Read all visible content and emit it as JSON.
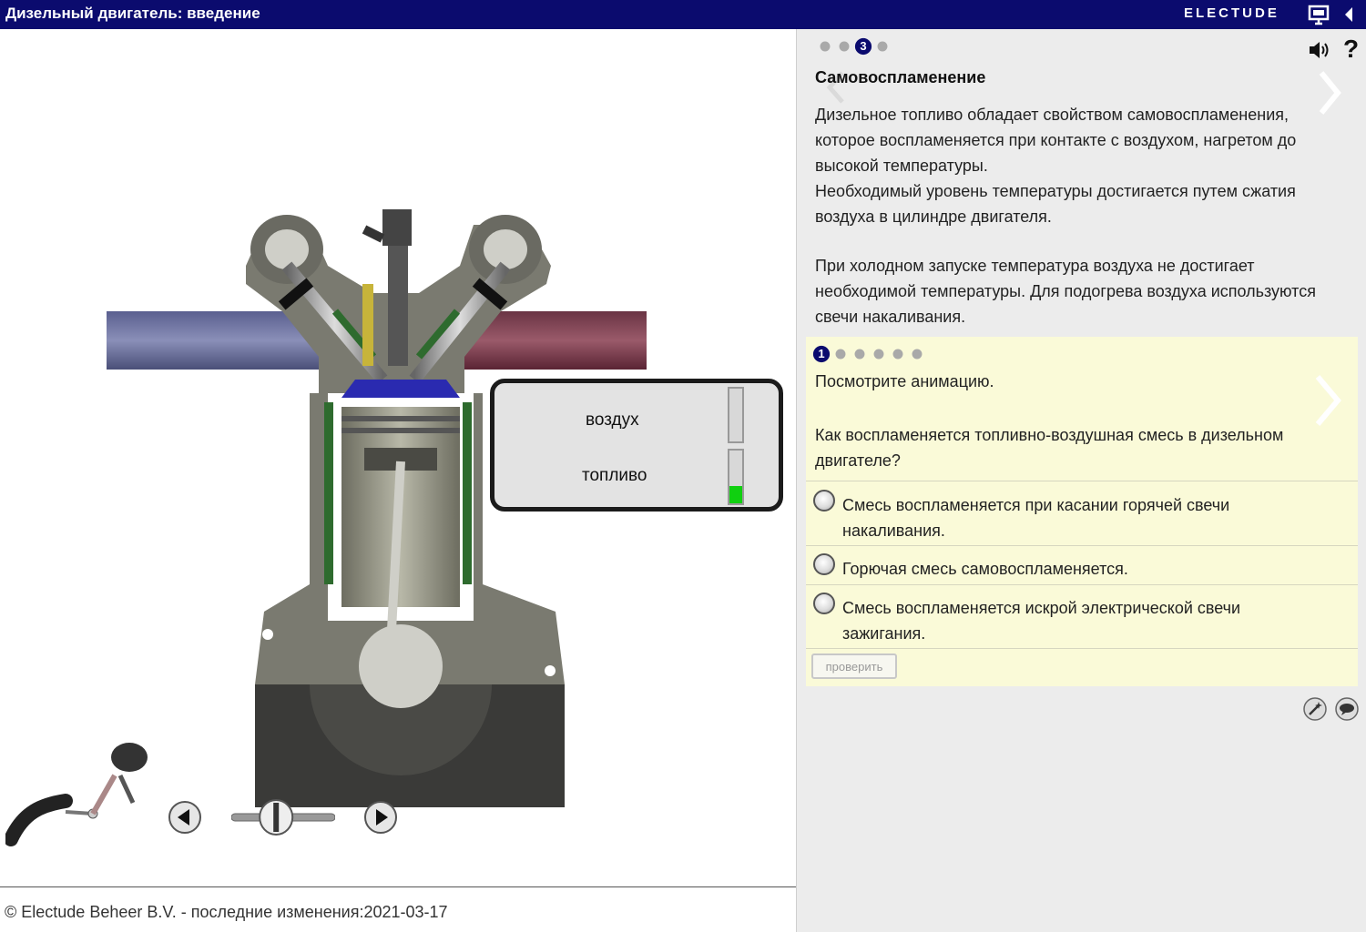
{
  "header": {
    "title": "Дизельный двигатель: введение",
    "brand": "ELECTUDE"
  },
  "animation": {
    "levels": [
      {
        "label": "воздух",
        "level": 0.0
      },
      {
        "label": "топливо",
        "level": 0.32
      }
    ],
    "slider_position": 0.4
  },
  "footer": {
    "copyright": "© Electude Beheer B.V. - последние изменения:2021-03-17"
  },
  "panel": {
    "page_dots": [
      "",
      "",
      "3",
      ""
    ],
    "active_page_dot": 2,
    "section_title": "Самовоспламенение",
    "paragraphs": [
      "Дизельное топливо обладает свойством самовоспламенения, которое воспламеняется при контакте с воздухом, нагретом до высокой температуры.",
      "Необходимый уровень температуры достигается путем сжатия воздуха в цилиндре двигателя.",
      "При холодном запуске температура воздуха не достигает необходимой температуры. Для подогрева воздуха используются свечи накаливания."
    ]
  },
  "quiz": {
    "dots": [
      "1",
      "",
      "",
      "",
      "",
      ""
    ],
    "active_dot": 0,
    "instruction": "Посмотрите анимацию.",
    "question": "Как воспламеняется топливно-воздушная смесь в дизельном двигателе?",
    "options": [
      "Смесь воспламеняется при касании горячей свечи накаливания.",
      "Горючая смесь самовоспламеняется.",
      "Смесь воспламеняется искрой электрической свечи зажигания."
    ],
    "check_button": "проверить"
  },
  "colors": {
    "header_bg": "#0b0b6e",
    "quiz_bg": "#fafad8",
    "panel_bg": "#ececec",
    "fuel_level": "#10d010"
  }
}
